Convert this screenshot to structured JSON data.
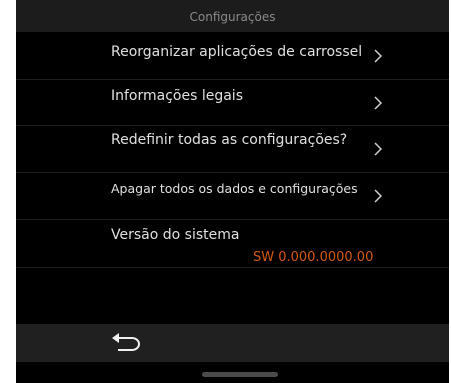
{
  "header": {
    "title": "Configurações"
  },
  "menu": {
    "items": [
      {
        "label": "Reorganizar aplicações de carrossel",
        "icon": "chevron-right-icon"
      },
      {
        "label": "Informações legais",
        "icon": "chevron-right-icon"
      },
      {
        "label": "Redefinir todas as configurações?",
        "icon": "chevron-right-icon"
      },
      {
        "label": "Apagar todos os dados e configurações",
        "icon": "chevron-right-icon"
      }
    ]
  },
  "system_version": {
    "label": "Versão do sistema",
    "value": "SW 0.000.0000.00"
  },
  "footer": {
    "back_icon": "back-arrow-icon"
  },
  "colors": {
    "background": "#000000",
    "header_background": "#1c1c1c",
    "text": "#e0e0e0",
    "header_text": "#8a8a8a",
    "accent": "#d35a14",
    "bottom_bar": "#202020"
  }
}
